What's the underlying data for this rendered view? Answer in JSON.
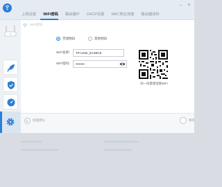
{
  "tabs": [
    "上网设置",
    "WiFi密码",
    "路由器IP",
    "DHCP设置",
    "MAC地址克隆",
    "路由器资料"
  ],
  "active_tab": "WiFi密码",
  "wifi": {
    "band_24": "无线频段",
    "band_5": "其他频段",
    "ssid_label": "WiFi名称：",
    "ssid_value": "TP-LINK_E14BC6",
    "password_label": "WiFi密码：",
    "password_value": "••••••••",
    "qr_caption": "扫一扫直接连接WiFi"
  },
  "footer": {
    "restore_label": "恢复默认",
    "save_label": "保存"
  },
  "colors": {
    "accent": "#2c7ed6",
    "sidebar_bg": "#eef1f5",
    "titlebar_bg": "#e4ebf3"
  },
  "icons": {
    "logo": "router-app-logo",
    "router": "router-device-icon",
    "side1": "rocket-icon",
    "side2": "shield-icon",
    "side3": "speedometer-icon",
    "side4": "gear-icon"
  }
}
